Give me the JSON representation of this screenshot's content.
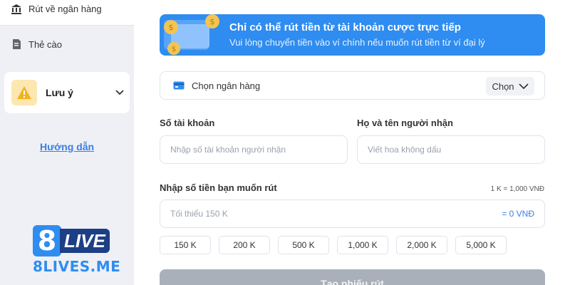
{
  "sidebar": {
    "items": [
      {
        "label": "Rút về ngân hàng",
        "icon": "bank-icon"
      },
      {
        "label": "Thẻ cào",
        "icon": "phone-card-icon"
      }
    ],
    "note": {
      "label": "Lưu ý",
      "icon": "warning-icon"
    },
    "guide_link": "Hướng dẫn",
    "logo": {
      "top": "8LIVE",
      "bottom": "8LIVES.ME"
    }
  },
  "banner": {
    "title": "Chỉ có thể rút tiền từ tài khoản cược trực tiếp",
    "subtitle": "Vui lòng chuyển tiền vào ví chính nếu muốn rút tiền từ ví đại lý"
  },
  "bank_select": {
    "label": "Chọn ngân hàng",
    "button": "Chọn"
  },
  "account": {
    "label": "Số tài khoản",
    "placeholder": "Nhập số tài khoản người nhận"
  },
  "recipient": {
    "label": "Họ và tên người nhận",
    "placeholder": "Viết hoa không dấu"
  },
  "amount": {
    "label": "Nhập số tiền bạn muốn rút",
    "rate": "1 K = 1,000 VNĐ",
    "placeholder": "Tối thiểu 150 K",
    "converted": "= 0 VNĐ"
  },
  "quick_amounts": [
    "150 K",
    "200 K",
    "500 K",
    "1,000 K",
    "2,000 K",
    "5,000 K"
  ],
  "submit": "Tạo phiếu rút",
  "colors": {
    "accent": "#2f8cf0",
    "link": "#3a7ee6",
    "disabled": "#a9b0b9",
    "warning": "#f3b321"
  }
}
